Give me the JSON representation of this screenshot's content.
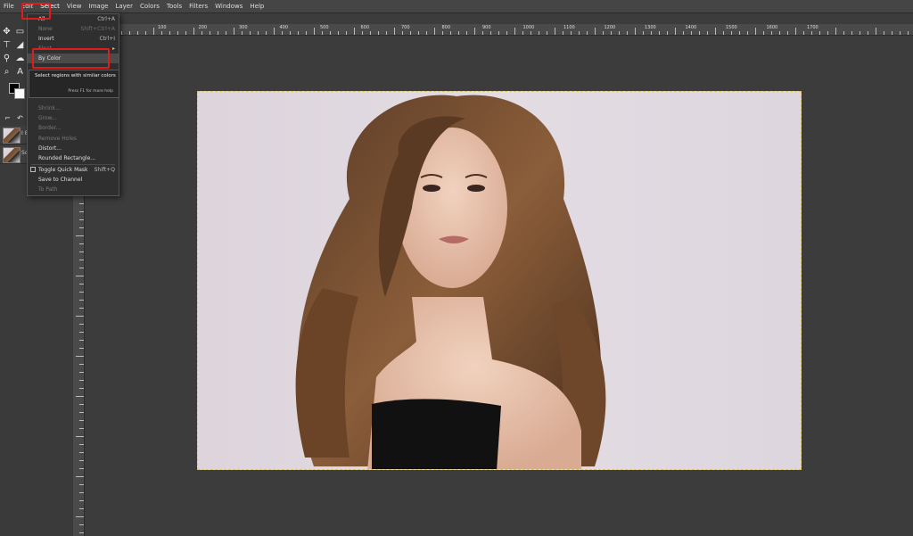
{
  "menubar": {
    "items": [
      "File",
      "Edit",
      "Select",
      "View",
      "Image",
      "Layer",
      "Colors",
      "Tools",
      "Filters",
      "Windows",
      "Help"
    ]
  },
  "select_menu": {
    "items": [
      {
        "label": "All",
        "shortcut": "Ctrl+A",
        "disabled": false
      },
      {
        "label": "None",
        "shortcut": "Shift+Ctrl+A",
        "disabled": true
      },
      {
        "label": "Invert",
        "shortcut": "Ctrl+I",
        "disabled": false
      },
      {
        "label": "Float",
        "shortcut": "",
        "disabled": true
      },
      {
        "label": "By Color",
        "shortcut": "",
        "disabled": false
      },
      {
        "label": "Shrink...",
        "shortcut": "",
        "disabled": true
      },
      {
        "label": "Grow...",
        "shortcut": "",
        "disabled": true
      },
      {
        "label": "Border...",
        "shortcut": "",
        "disabled": true
      },
      {
        "label": "Remove Holes",
        "shortcut": "",
        "disabled": true
      },
      {
        "label": "Distort...",
        "shortcut": "",
        "disabled": false
      },
      {
        "label": "Rounded Rectangle...",
        "shortcut": "",
        "disabled": false
      },
      {
        "label": "Toggle Quick Mask",
        "shortcut": "Shift+Q",
        "disabled": false
      },
      {
        "label": "Save to Channel",
        "shortcut": "",
        "disabled": false
      },
      {
        "label": "To Path",
        "shortcut": "",
        "disabled": true
      }
    ]
  },
  "tooltip": {
    "text": "Select regions with similar colors",
    "help": "Press F1 for more help"
  },
  "ruler_top": {
    "labels": [
      "100",
      "200",
      "300",
      "400",
      "500",
      "600",
      "700",
      "800",
      "900",
      "1000",
      "1100",
      "1200",
      "1300",
      "1400",
      "1500",
      "1600",
      "1700"
    ]
  },
  "layers": [
    {
      "name": "I 8"
    },
    {
      "name": "Sc"
    }
  ],
  "colors": {
    "foreground": "#000000",
    "background": "#ffffff",
    "highlight_box": "#e01b1b"
  }
}
